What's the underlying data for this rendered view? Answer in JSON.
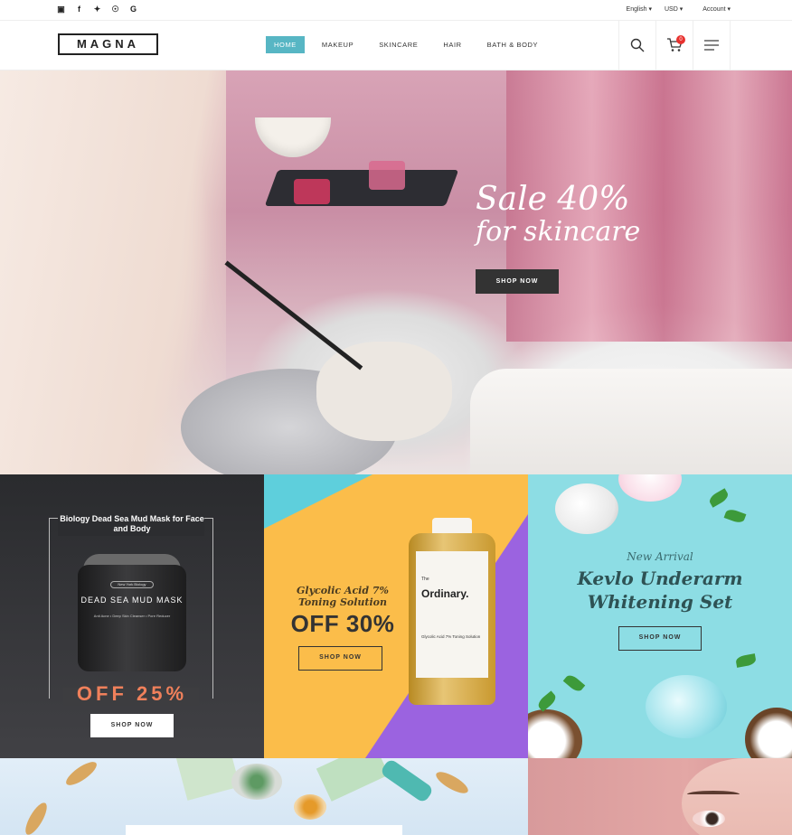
{
  "topbar": {
    "social_icons": [
      "instagram-icon",
      "facebook-icon",
      "twitter-icon",
      "pinterest-icon",
      "google-icon"
    ],
    "language": "English",
    "currency": "USD",
    "account": "Account"
  },
  "header": {
    "logo": "MAGNA",
    "nav": [
      "HOME",
      "MAKEUP",
      "SKINCARE",
      "HAIR",
      "BATH & BODY"
    ],
    "active_nav": "HOME",
    "cart_count": "0",
    "accent_color": "#57b6c4"
  },
  "hero": {
    "line1": "Sale 40%",
    "line2": "for skincare",
    "button": "SHOP NOW"
  },
  "promo1": {
    "title": "Biology Dead Sea Mud Mask for Face and Body",
    "jar_brand": "New York Biology",
    "jar_label": "DEAD SEA MUD MASK",
    "jar_sub": "Anti Acne • Deep Skin Cleanser • Pore Reducer",
    "offer": "OFF 25%",
    "button": "SHOP NOW",
    "offer_color": "#f0805b"
  },
  "promo2": {
    "subtitle": "Glycolic Acid 7% Toning Solution",
    "offer": "OFF 30%",
    "button": "SHOP NOW",
    "bottle_small": "The",
    "bottle_brand": "Ordinary.",
    "bottle_desc": "Glycolic Acid 7% Toning Solution"
  },
  "promo3": {
    "tag": "New Arrival",
    "title": "Kevlo Underarm Whitening Set",
    "button": "SHOP NOW"
  }
}
